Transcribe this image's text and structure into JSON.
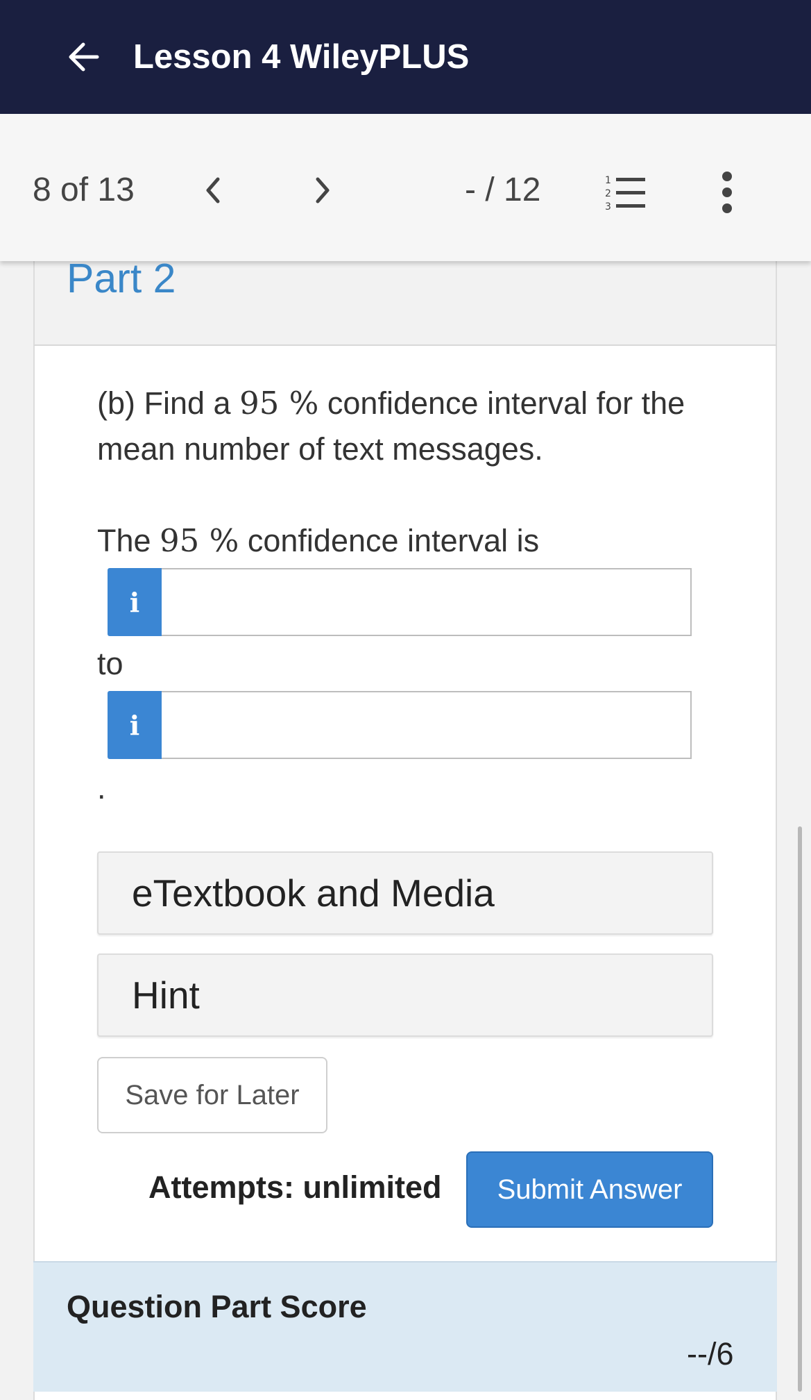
{
  "header": {
    "title": "Lesson 4 WileyPLUS",
    "back_icon": "arrow-left-icon"
  },
  "navbar": {
    "position": "8 of 13",
    "prev_icon": "chevron-left-icon",
    "next_icon": "chevron-right-icon",
    "score": "- / 12",
    "list_icon": "numbered-list-icon",
    "more_icon": "more-vertical-icon"
  },
  "part": {
    "title": "Part 2"
  },
  "question": {
    "prefix": "(b) Find a ",
    "confidence": "95 %",
    "suffix": " confidence interval for the mean number of text messages."
  },
  "stem": {
    "prefix": "The ",
    "confidence": "95 %",
    "suffix": " confidence interval is"
  },
  "answers": [
    {
      "info_label": "i",
      "value": "",
      "placeholder": ""
    },
    {
      "info_label": "i",
      "value": "",
      "placeholder": ""
    }
  ],
  "to_label": "to",
  "period": ".",
  "resources": {
    "etextbook": "eTextbook and Media",
    "hint": "Hint"
  },
  "actions": {
    "save": "Save for Later",
    "attempts": "Attempts: unlimited",
    "submit": "Submit Answer"
  },
  "score_panel": {
    "title": "Question Part Score",
    "value": "--/6"
  },
  "colors": {
    "header_bg": "#1a1f40",
    "accent": "#3b86d3",
    "part_title": "#3a87c8",
    "score_bg": "#dbe9f3"
  }
}
